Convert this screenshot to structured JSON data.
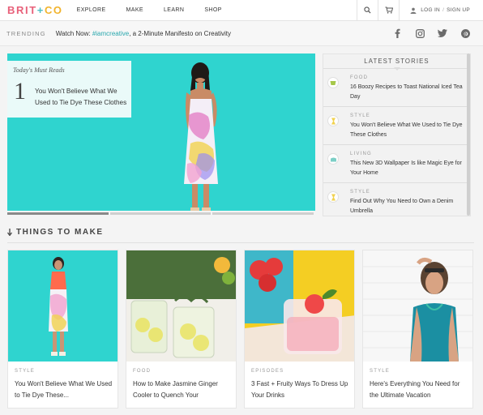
{
  "brand": {
    "logo_brit": "BRIT",
    "logo_plus": "+",
    "logo_co": "CO"
  },
  "nav": {
    "items": [
      "EXPLORE",
      "MAKE",
      "LEARN",
      "SHOP"
    ],
    "login": "LOG IN",
    "sep": "/",
    "signup": "SIGN UP"
  },
  "trending": {
    "label": "TRENDING",
    "prefix": "Watch Now: ",
    "hashtag": "#iamcreative",
    "suffix": ", a 2-Minute Manifesto on Creativity"
  },
  "hero": {
    "caption": "Today's Must Reads",
    "number": "1",
    "title": "You Won't Believe What We Used to Tie Dye These Clothes"
  },
  "latest": {
    "header": "LATEST STORIES",
    "stories": [
      {
        "category": "FOOD",
        "title": "16 Boozy Recipes to Toast National Iced Tea Day",
        "icon": "food-icon"
      },
      {
        "category": "STYLE",
        "title": "You Won't Believe What We Used to Tie Dye These Clothes",
        "icon": "style-icon"
      },
      {
        "category": "LIVING",
        "title": "This New 3D Wallpaper Is like Magic Eye for Your Home",
        "icon": "living-icon"
      },
      {
        "category": "STYLE",
        "title": "Find Out Why You Need to Own a Denim Umbrella",
        "icon": "style-icon"
      }
    ]
  },
  "section": {
    "title": "THINGS TO MAKE"
  },
  "cards": [
    {
      "category": "STYLE",
      "title": "You Won't Believe What We Used to Tie Dye These..."
    },
    {
      "category": "FOOD",
      "title": "How to Make Jasmine Ginger Cooler to Quench Your"
    },
    {
      "category": "EPISODES",
      "title": "3 Fast + Fruity Ways To Dress Up Your Drinks"
    },
    {
      "category": "STYLE",
      "title": "Here's Everything You Need for the Ultimate Vacation"
    }
  ],
  "colors": {
    "accent_teal": "#2fd4cf",
    "brand_pink": "#e8607a",
    "brand_yellow": "#f1b32c",
    "link": "#2aa7ad"
  }
}
